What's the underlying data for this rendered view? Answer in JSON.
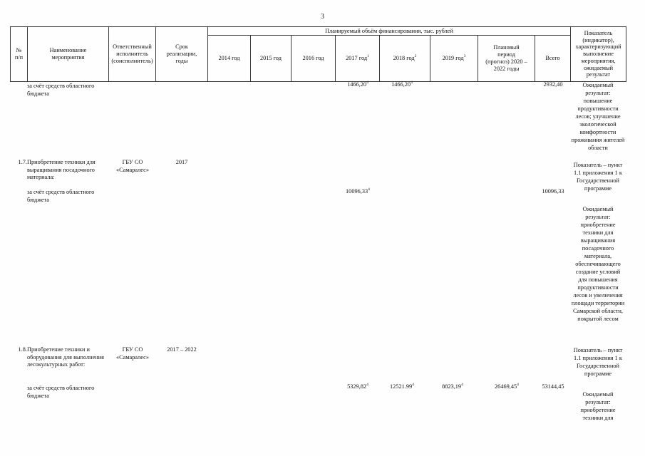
{
  "page": {
    "number": "3"
  },
  "table": {
    "group_header": "Планируемый объём финансирования, тыс. рублей",
    "columns": [
      {
        "label_line1": "№",
        "label_line2": "п/п"
      },
      {
        "label_line1": "Наименование",
        "label_line2": "мероприятия"
      },
      {
        "label_line1": "Ответственный",
        "label_line2": "исполнитель",
        "label_line3": "(соисполнитель)"
      },
      {
        "label_line1": "Срок",
        "label_line2": "реализации,",
        "label_line3": "годы"
      },
      {
        "label": "2014 год"
      },
      {
        "label": "2015 год"
      },
      {
        "label": "2016 год"
      },
      {
        "label": "2017 год",
        "sup": "1"
      },
      {
        "label": "2018 год",
        "sup": "2"
      },
      {
        "label": "2019 год",
        "sup": "3"
      },
      {
        "label_line1": "Плановый",
        "label_line2": "период",
        "label_line3": "(прогноз) 2020 –",
        "label_line4": "2022 годы"
      },
      {
        "label": "Всего"
      },
      {
        "label_line1": "Показатель",
        "label_line2": "(индикатор),",
        "label_line3": "характеризующий",
        "label_line4": "выполнение",
        "label_line5": "мероприятия,",
        "label_line6": "ожидаемый",
        "label_line7": "результат"
      }
    ]
  },
  "rows": {
    "continued": {
      "name": "за счёт средств областного бюджета",
      "y2017": "1466,20",
      "y2017_sup": "4",
      "y2018": "1466,20",
      "y2018_sup": "4",
      "total": "2932,40",
      "indicator": "Ожидаемый результат: повышение продуктивности лесов; улучшение экологической комфортности проживания жителей области"
    },
    "r17": {
      "number": "1.7.",
      "name": "Приобретение техники для выращивания посадочного материала:",
      "executor_line1": "ГБУ СО",
      "executor_line2": "«Самаралес»",
      "term": "2017",
      "subname": "за счёт средств областного бюджета",
      "y2017": "10096,33",
      "y2017_sup": "4",
      "total": "10096,33",
      "indicator_1": "Показатель – пункт 1.1 приложения 1 к Государственной программе",
      "indicator_2": "Ожидаемый результат: приобретение техники для выращивания посадочного материала, обеспечивающего создание условий для повышения продуктивности лесов и увеличения площади территории Самарской области, покрытой лесом"
    },
    "r18": {
      "number": "1.8.",
      "name": "Приобретение техники и оборудования для выполнения лесокультурных работ:",
      "executor_line1": "ГБУ СО",
      "executor_line2": "«Самаралес»",
      "term": "2017 – 2022",
      "subname": "за счёт средств областного бюджета",
      "y2017": "5329,82",
      "y2017_sup": "4",
      "y2018": "12521.99",
      "y2018_sup": "4",
      "y2019": "8823,19",
      "y2019_sup": "4",
      "plan": "26469,45",
      "plan_sup": "4",
      "total": "53144,45",
      "indicator_1": "Показатель – пункт 1.1 приложения 1 к Государственной программе",
      "indicator_2": "Ожидаемый результат: приобретение техники для"
    }
  }
}
